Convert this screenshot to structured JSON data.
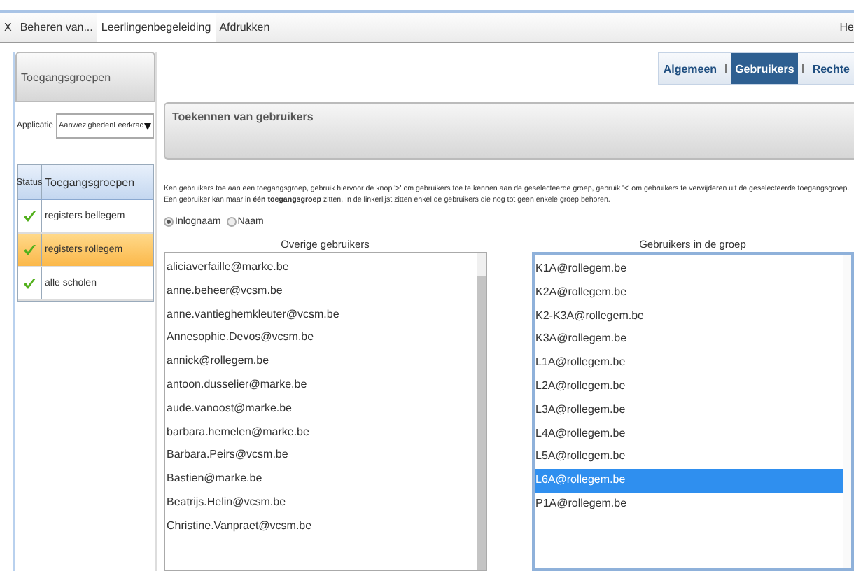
{
  "menu": [
    {
      "label": "X",
      "selected": false
    },
    {
      "label": "Beheren van...",
      "selected": false
    },
    {
      "label": "Leerlingenbegeleiding",
      "selected": true
    },
    {
      "label": "Afdrukken",
      "selected": false
    }
  ],
  "menu_right": "He",
  "sidebar": {
    "title": "Toegangsgroepen",
    "app_label": "Applicatie",
    "app_value": "AanwezighedenLeerkrac",
    "columns": [
      "Status",
      "Toegangsgroepen"
    ],
    "rows": [
      {
        "name": "registers bellegem",
        "selected": false,
        "active": true
      },
      {
        "name": "registers rollegem",
        "selected": true,
        "active": true
      },
      {
        "name": "alle scholen",
        "selected": false,
        "active": true
      }
    ]
  },
  "tabs": [
    {
      "label": "Algemeen",
      "selected": false
    },
    {
      "label": "Gebruikers",
      "selected": true
    },
    {
      "label": "Rechte",
      "selected": false
    }
  ],
  "section_title": "Toekennen van gebruikers",
  "instructions": "Ken gebruikers toe aan een toegangsgroep, gebruik hiervoor de knop '>' om gebruikers toe te kennen aan de geselecteerde groep, gebruik '<' om gebruikers te verwijderen uit de geselecteerde toegangsgroep.  Een gebruiker kan maar in **één toegangsgroep** zitten. In de linkerlijst zitten enkel de gebruikers die nog tot geen enkele groep behoren.",
  "radios": [
    {
      "label": "Inlognaam",
      "selected": true
    },
    {
      "label": "Naam",
      "selected": false
    }
  ],
  "available": {
    "title": "Overige gebruikers",
    "items": [
      {
        "label": "aliciaverfaille@marke.be",
        "selected": false
      },
      {
        "label": "anne.beheer@vcsm.be",
        "selected": false
      },
      {
        "label": "anne.vantieghemkleuter@vcsm.be",
        "selected": false
      },
      {
        "label": "Annesophie.Devos@vcsm.be",
        "selected": false
      },
      {
        "label": "annick@rollegem.be",
        "selected": false
      },
      {
        "label": "antoon.dusselier@marke.be",
        "selected": false
      },
      {
        "label": "aude.vanoost@marke.be",
        "selected": false
      },
      {
        "label": "barbara.hemelen@marke.be",
        "selected": false
      },
      {
        "label": "Barbara.Peirs@vcsm.be",
        "selected": false
      },
      {
        "label": "Bastien@marke.be",
        "selected": false
      },
      {
        "label": "Beatrijs.Helin@vcsm.be",
        "selected": false
      },
      {
        "label": "Christine.Vanpraet@vcsm.be",
        "selected": false
      }
    ]
  },
  "members": {
    "title": "Gebruikers in de groep",
    "items": [
      {
        "label": "K1A@rollegem.be",
        "selected": false
      },
      {
        "label": "K2A@rollegem.be",
        "selected": false
      },
      {
        "label": "K2-K3A@rollegem.be",
        "selected": false
      },
      {
        "label": "K3A@rollegem.be",
        "selected": false
      },
      {
        "label": "L1A@rollegem.be",
        "selected": false
      },
      {
        "label": "L2A@rollegem.be",
        "selected": false
      },
      {
        "label": "L3A@rollegem.be",
        "selected": false
      },
      {
        "label": "L4A@rollegem.be",
        "selected": false
      },
      {
        "label": "L5A@rollegem.be",
        "selected": false
      },
      {
        "label": "L6A@rollegem.be",
        "selected": true
      },
      {
        "label": "P1A@rollegem.be",
        "selected": false
      }
    ]
  }
}
